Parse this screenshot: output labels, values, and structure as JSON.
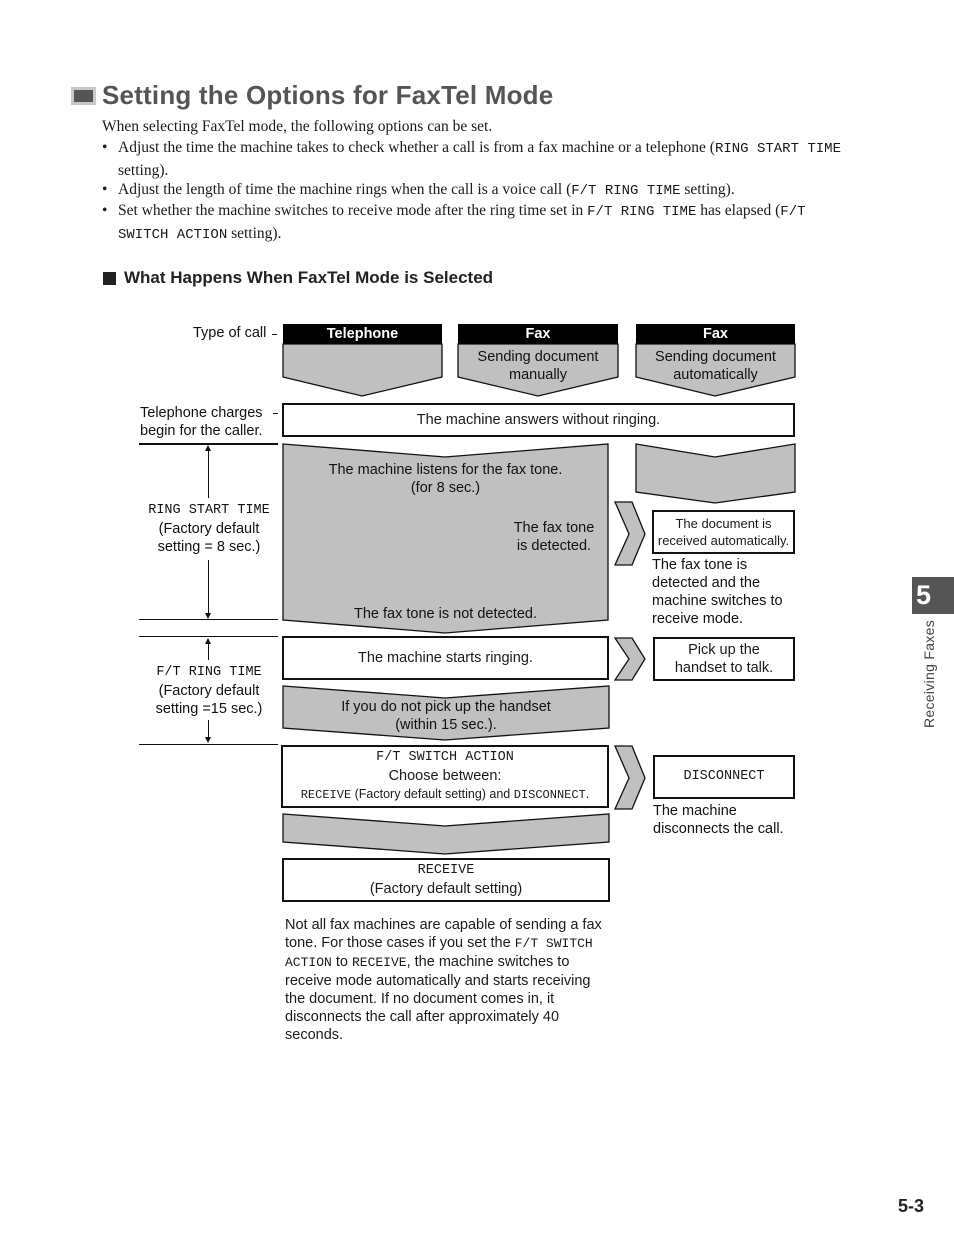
{
  "page": {
    "title": "Setting the Options for FaxTel Mode",
    "intro": "When selecting FaxTel mode, the following options can be set.",
    "bullets": [
      {
        "before": "Adjust the time the machine takes to check whether a call is from a fax machine or a telephone (",
        "code": "RING START TIME",
        "after": " setting)."
      },
      {
        "before": "Adjust the length of time the machine rings when the call is a voice call (",
        "code": "F/T RING TIME",
        "after": " setting)."
      },
      {
        "before": "Set whether the machine switches to receive mode after the ring time set in ",
        "code": "F/T RING TIME",
        "middle": " has elapsed (",
        "code2": "F/T SWITCH ACTION",
        "after": " setting)."
      }
    ],
    "bullet_char": "•",
    "subheading": "What Happens When FaxTel Mode is Selected",
    "side_tab": {
      "number": "5",
      "label": "Receiving Faxes"
    },
    "page_number": "5-3"
  },
  "diagram": {
    "type_of_call_label": "Type of call",
    "charges_label_line1": "Telephone charges",
    "charges_label_line2": "begin for the caller.",
    "columns": [
      {
        "header": "Telephone",
        "sub1": "",
        "sub2": ""
      },
      {
        "header": "Fax",
        "sub1": "Sending document",
        "sub2": "manually"
      },
      {
        "header": "Fax",
        "sub1": "Sending document",
        "sub2": "automatically"
      }
    ],
    "answers_box": "The machine answers without ringing.",
    "ring_start": {
      "setting": "RING START TIME",
      "line1": "(Factory default",
      "line2": "setting = 8 sec.)"
    },
    "listen_line1": "The machine listens for the fax tone.",
    "listen_line2": "(for 8 sec.)",
    "detected_line1": "The fax tone",
    "detected_line2": "is detected.",
    "not_detected": "The fax tone is not detected.",
    "received_box_line1": "The document is",
    "received_box_line2": "received automatically.",
    "received_note": [
      "The fax tone is",
      "detected and the",
      "machine switches to",
      "receive mode."
    ],
    "ft_ring": {
      "setting": "F/T RING TIME",
      "line1": "(Factory default",
      "line2": "setting =15 sec.)"
    },
    "starts_ringing": "The machine starts ringing.",
    "pickup_box_line1": "Pick up the",
    "pickup_box_line2": "handset to talk.",
    "no_pickup_line1": "If you do not pick up the handset",
    "no_pickup_line2": "(within 15 sec.).",
    "switch_action": {
      "setting": "F/T SWITCH ACTION",
      "choose": "Choose between:",
      "opt1": "RECEIVE",
      "opt1_note": " (Factory default setting) and ",
      "opt2": "DISCONNECT",
      "end": "."
    },
    "disconnect_box": "DISCONNECT",
    "disconnect_note_line1": "The machine",
    "disconnect_note_line2": "disconnects the call.",
    "receive_box_line1": "RECEIVE",
    "receive_box_line2": "(Factory default setting)",
    "footnote": {
      "t1": "Not all fax machines are capable of sending a fax tone. For those cases if you set the ",
      "c1": "F/T SWITCH ACTION",
      "t2": " to ",
      "c2": "RECEIVE",
      "t3": ", the machine switches to receive mode automatically and starts receiving the document. If no document comes in, it disconnects the call after approximately 40 seconds."
    }
  },
  "colors": {
    "title_gray": "#555555",
    "shape_fill": "#c0c0c0",
    "header_black": "#000000",
    "tab_gray": "#555555"
  }
}
